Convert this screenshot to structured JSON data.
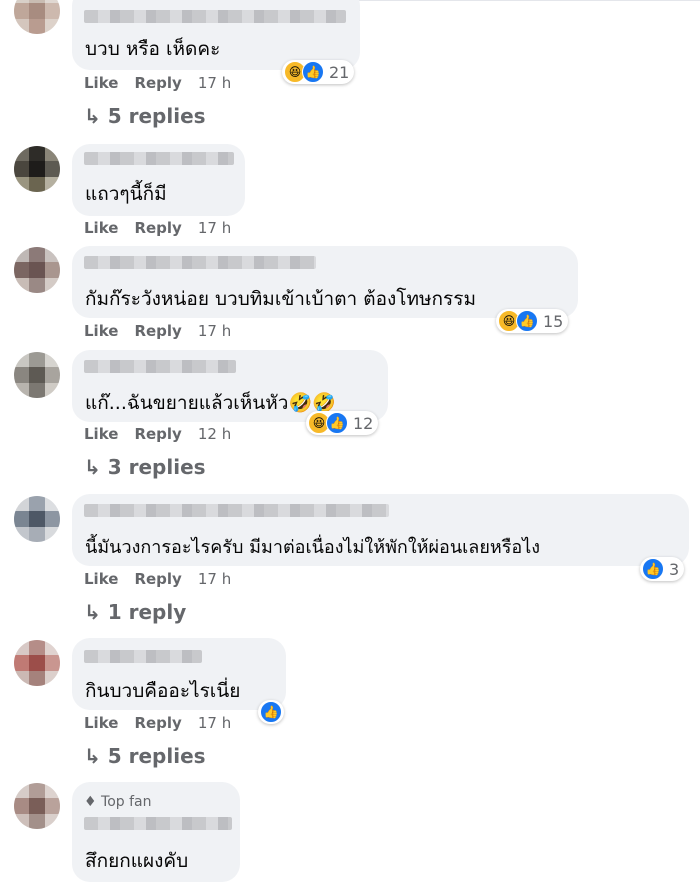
{
  "labels": {
    "like": "Like",
    "reply": "Reply",
    "top_fan": "Top fan"
  },
  "reply_arrow": "↳",
  "comments": [
    {
      "text": "บวบ หรือ เห็ดคะ",
      "time": "17 h",
      "reaction_count": "21",
      "replies": "5 replies"
    },
    {
      "text": "แถวๆนี้ก็มี",
      "time": "17 h"
    },
    {
      "text": "กัมก๊ระวังหน่อย บวบทิมเข้าเบ้าตา ต้องโทษกรรม",
      "time": "17 h",
      "reaction_count": "15"
    },
    {
      "text": "แก๊...ฉันขยายแล้วเห็นหัว🤣🤣",
      "time": "12 h",
      "reaction_count": "12",
      "replies": "3 replies"
    },
    {
      "text": "นี้มันวงการอะไรครับ มีมาต่อเนื่องไม่ให้พักให้ผ่อนเลยหรือไง",
      "time": "17 h",
      "reaction_count": "3",
      "replies": "1 reply"
    },
    {
      "text": "กินบวบคืออะไรเนี่ย",
      "time": "17 h",
      "replies": "5 replies"
    },
    {
      "text": "สึกยกแผงคับ",
      "top_fan": true
    }
  ],
  "reaction_icons": {
    "haha": "😆",
    "like": "👍"
  },
  "colors": {
    "bubble": "#f0f2f5",
    "meta": "#65676b",
    "like_blue": "#1877f2",
    "haha_yellow": "#f7b928"
  }
}
